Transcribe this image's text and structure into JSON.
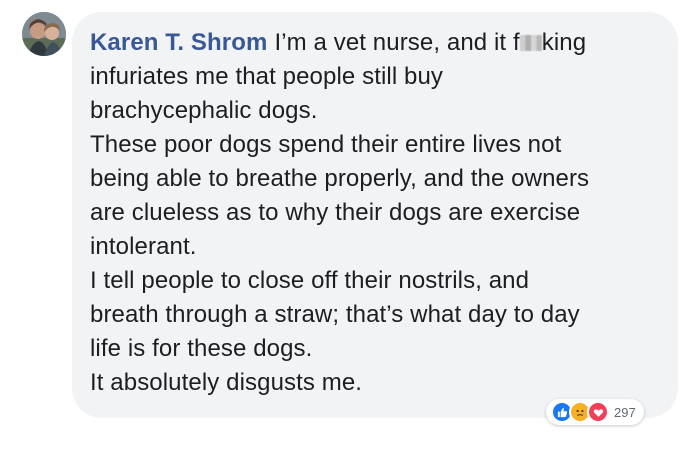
{
  "comment": {
    "author": "Karen T. Shrom",
    "text_lines": [
      "I’m a vet nurse, and it f",
      "king",
      "infuriates me that people still buy",
      "brachycephalic dogs.",
      "These poor dogs spend their entire lives not",
      "being able to breathe properly, and the owners",
      "are clueless as to why their dogs are exercise",
      "intolerant.",
      "I tell people to close off their nostrils, and",
      "breath through a straw; that’s what day to day",
      "life is for these dogs.",
      "It absolutely disgusts me."
    ]
  },
  "reactions": {
    "icons": [
      "like-icon",
      "sad-icon",
      "love-icon"
    ],
    "count": "297"
  },
  "colors": {
    "author": "#385898",
    "bubble": "#f2f3f5",
    "text": "#1c1e21",
    "like": "#1877f2",
    "sad": "#f7b125",
    "love": "#f33e58"
  }
}
